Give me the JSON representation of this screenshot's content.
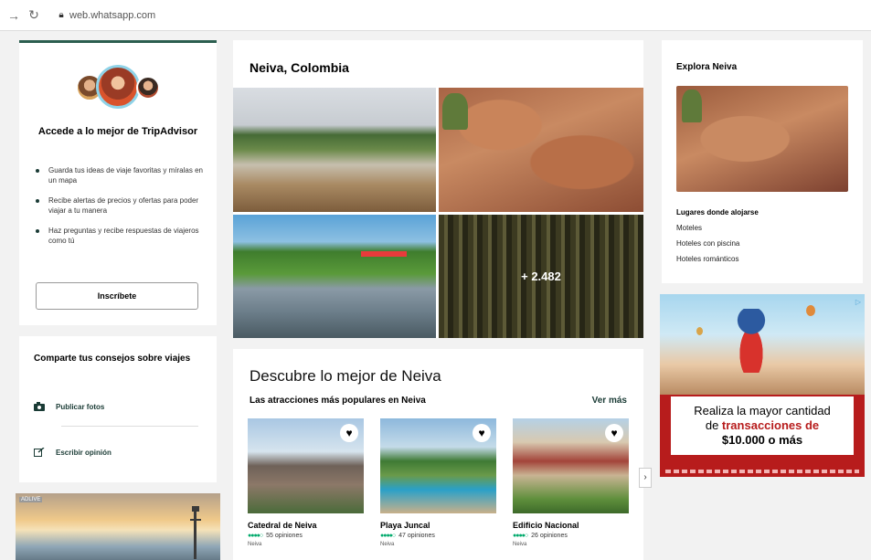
{
  "browser": {
    "back_icon": "arrow-right-icon",
    "reload_icon": "reload-icon",
    "lock_icon": "lock-icon",
    "url": "web.whatsapp.com"
  },
  "signup": {
    "title": "Accede a lo mejor de TripAdvisor",
    "bullets": [
      "Guarda tus ideas de viaje favoritas y míralas en un mapa",
      "Recibe alertas de precios y ofertas para poder viajar a tu manera",
      "Haz preguntas y recibe respuestas de viajeros como tú"
    ],
    "button": "Inscríbete"
  },
  "share": {
    "title": "Comparte tus consejos sobre viajes",
    "items": [
      {
        "label": "Publicar fotos",
        "icon": "camera-icon"
      },
      {
        "label": "Escribir opinión",
        "icon": "edit-icon"
      }
    ]
  },
  "left_ad": {
    "tag": "ADLIVE"
  },
  "neiva": {
    "title": "Neiva, Colombia",
    "more_photos": "+ 2.482"
  },
  "discover": {
    "title": "Descubre lo mejor de Neiva",
    "subtitle": "Las atracciones más populares en Neiva",
    "see_more": "Ver más",
    "attractions": [
      {
        "name": "Catedral de Neiva",
        "reviews": "55 opiniones",
        "location": "Neiva",
        "rating": 4
      },
      {
        "name": "Playa Juncal",
        "reviews": "47 opiniones",
        "location": "Neiva",
        "rating": 4
      },
      {
        "name": "Edificio Nacional",
        "reviews": "26 opiniones",
        "location": "Neiva",
        "rating": 4
      }
    ],
    "next": "›"
  },
  "explore": {
    "title": "Explora Neiva",
    "links": [
      "Lugares donde alojarse",
      "Moteles",
      "Hoteles con piscina",
      "Hoteles románticos"
    ]
  },
  "promo": {
    "line1": "Realiza la mayor cantidad",
    "line2_pre": "de ",
    "line2_bold": "transacciones de",
    "line3": "$10.000 o más",
    "ad_choice": "▷"
  },
  "colors": {
    "tripadvisor_green": "#2b5e4f",
    "rating_green": "#00aa6c",
    "promo_red": "#b71c1c"
  }
}
